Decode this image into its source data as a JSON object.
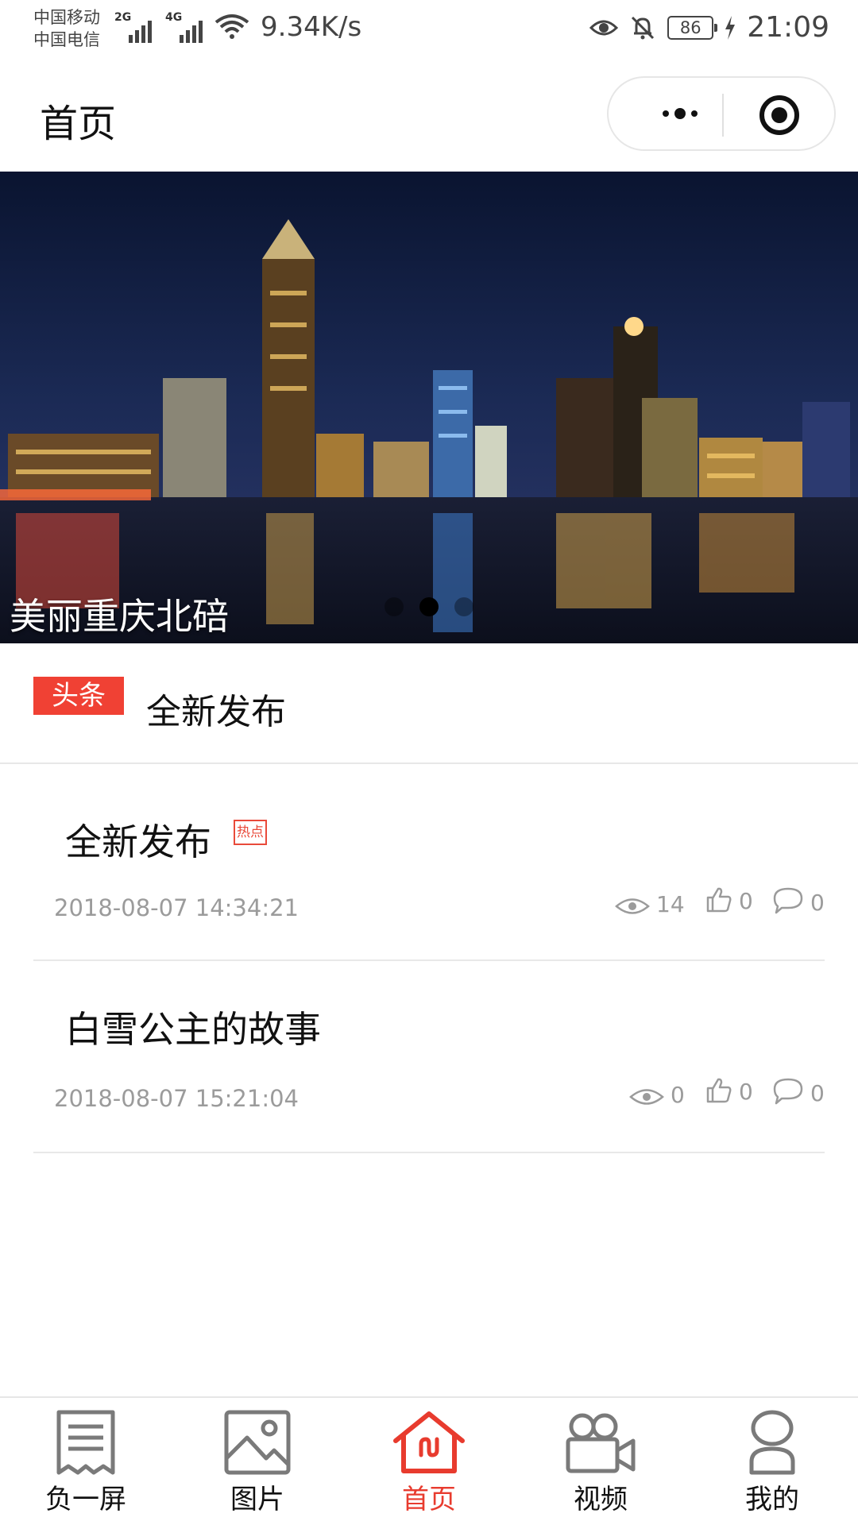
{
  "status_bar": {
    "carrier_1": "中国移动",
    "carrier_2": "中国电信",
    "signal_1_type": "2G",
    "signal_2_type": "4G",
    "net_speed": "9.34K/s",
    "battery": "86",
    "time": "21:09"
  },
  "title_bar": {
    "title": "首页",
    "more_icon": "more-dots-icon",
    "close_icon": "target-circle-icon"
  },
  "banner": {
    "caption": "美丽重庆北碚",
    "slide_count": 3,
    "active_slide": 2
  },
  "headline": {
    "badge": "头条",
    "text": "全新发布"
  },
  "articles": [
    {
      "title": "全新发布",
      "tag": "热点",
      "date": "2018-08-07 14:34:21",
      "views": "14",
      "likes": "0",
      "comments": "0"
    },
    {
      "title": "白雪公主的故事",
      "date": "2018-08-07 15:21:04",
      "views": "0",
      "likes": "0",
      "comments": "0"
    }
  ],
  "tab_bar": {
    "accent_color": "#e83b2e",
    "tabs": [
      {
        "label": "负一屏",
        "icon": "receipt-icon"
      },
      {
        "label": "图片",
        "icon": "image-icon"
      },
      {
        "label": "首页",
        "icon": "home-icon",
        "active": true
      },
      {
        "label": "视频",
        "icon": "video-camera-icon"
      },
      {
        "label": "我的",
        "icon": "person-icon"
      }
    ]
  }
}
